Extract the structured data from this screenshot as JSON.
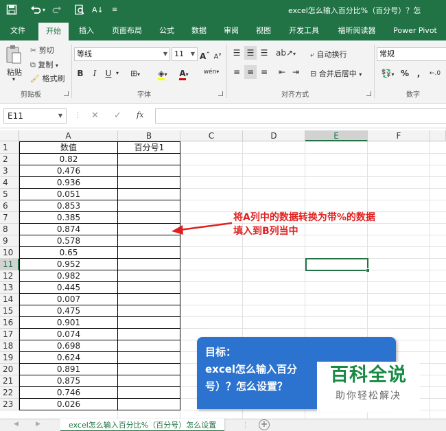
{
  "title_bar": {
    "doc_title": "excel怎么输入百分比%（百分号）？怎",
    "save_icon": "save-icon",
    "undo_icon": "undo-icon",
    "redo_icon": "redo-icon",
    "print_preview_icon": "print-preview-icon",
    "sort_icon": "sort-az-icon",
    "customize_icon": "customize-qat-icon"
  },
  "ribbon_tabs": [
    "文件",
    "开始",
    "插入",
    "页面布局",
    "公式",
    "数据",
    "审阅",
    "视图",
    "开发工具",
    "福昕阅读器",
    "Power Pivot"
  ],
  "active_tab": "开始",
  "ribbon": {
    "clipboard": {
      "paste": "粘贴",
      "cut": "剪切",
      "copy": "复制",
      "format_painter": "格式刷",
      "group_label": "剪贴板"
    },
    "font": {
      "font_name": "等线",
      "font_size": "11",
      "bold": "B",
      "italic": "I",
      "underline": "U",
      "grow": "A",
      "shrink": "A",
      "wen": "wén",
      "font_color_letter": "A",
      "group_label": "字体"
    },
    "alignment": {
      "wrap_text": "自动换行",
      "merge_center": "合并后居中",
      "group_label": "对齐方式"
    },
    "number": {
      "format": "常规",
      "percent": "%",
      "comma": ",",
      "group_label": "数字"
    }
  },
  "formula_bar": {
    "name_box": "E11",
    "cancel": "✕",
    "enter": "✓",
    "fx": "fx",
    "value": ""
  },
  "sheet": {
    "columns": [
      "A",
      "B",
      "C",
      "D",
      "E",
      "F"
    ],
    "selected_column": "E",
    "selected_row": "11",
    "rows": [
      "1",
      "2",
      "3",
      "4",
      "5",
      "6",
      "7",
      "8",
      "9",
      "10",
      "11",
      "12",
      "13",
      "14",
      "15",
      "16",
      "17",
      "18",
      "19",
      "20",
      "21",
      "22",
      "23"
    ],
    "header_a": "数值",
    "header_b": "百分号1",
    "values": [
      "0.82",
      "0.476",
      "0.936",
      "0.051",
      "0.853",
      "0.385",
      "0.874",
      "0.578",
      "0.65",
      "0.952",
      "0.982",
      "0.445",
      "0.007",
      "0.475",
      "0.901",
      "0.074",
      "0.698",
      "0.624",
      "0.891",
      "0.875",
      "0.746",
      "0.026"
    ]
  },
  "annotation": {
    "line1": "将A列中的数据转换为带%的数据",
    "line2": "填入到B列当中",
    "color": "#e02020"
  },
  "goal": {
    "line1": "目标：",
    "line2": "excel怎么输入百分",
    "line3": "号）？怎么设置？",
    "color": "#2b73cf"
  },
  "watermark": {
    "big": "百科全说",
    "small": "助你轻松解决"
  },
  "sheet_tabs": {
    "active": "excel怎么输入百分比%（百分号）怎么设置",
    "add_icon": "add-sheet-icon"
  },
  "colors": {
    "excel_green": "#217346",
    "ribbon_bg": "#f3f3f3"
  }
}
